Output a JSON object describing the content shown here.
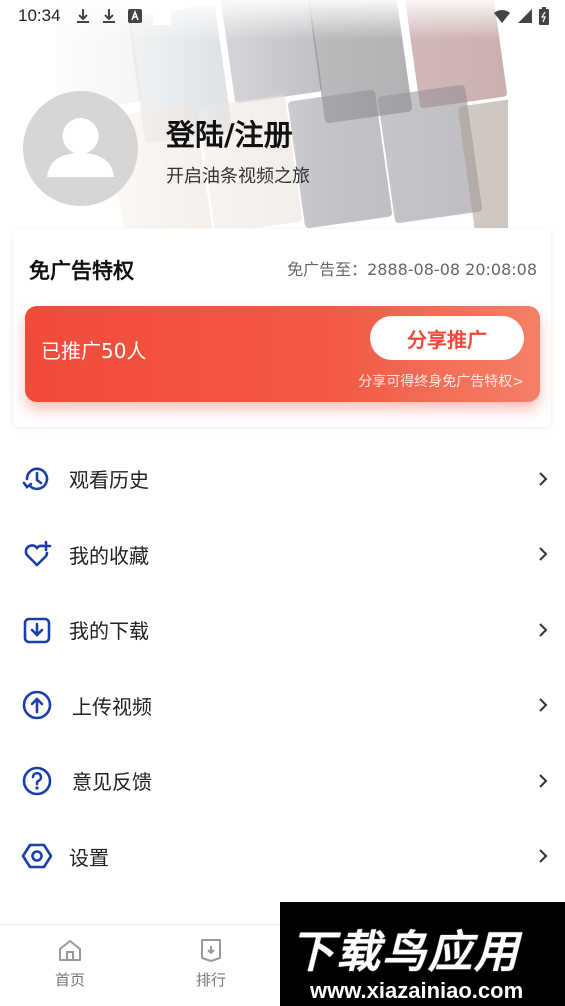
{
  "status_bar": {
    "time": "10:34",
    "left_icons": [
      "download-icon",
      "download-icon",
      "a-icon",
      "blank-square-icon"
    ],
    "right_icons": [
      "wifi-icon",
      "cellular-signal-icon",
      "battery-icon"
    ]
  },
  "profile": {
    "title": "登陆/注册",
    "subtitle": "开启油条视频之旅",
    "avatar_icon": "user-avatar-icon"
  },
  "vip": {
    "title": "免广告特权",
    "expire": "免广告至：2888-08-08 20:08:08",
    "promo_count": "已推广50人",
    "share_button": "分享推广",
    "share_tip": "分享可得终身免广告特权>"
  },
  "menu": [
    {
      "label": "观看历史",
      "icon": "history-icon"
    },
    {
      "label": "我的收藏",
      "icon": "heart-plus-icon"
    },
    {
      "label": "我的下载",
      "icon": "download-box-icon"
    },
    {
      "label": "上传视频",
      "icon": "upload-circle-icon"
    },
    {
      "label": "意见反馈",
      "icon": "question-circle-icon"
    },
    {
      "label": "设置",
      "icon": "settings-hexagon-icon"
    }
  ],
  "bottom_nav": [
    {
      "label": "首页",
      "icon": "home-icon"
    },
    {
      "label": "排行",
      "icon": "ranking-icon"
    }
  ],
  "watermark": {
    "logo_text": "下载鸟应用",
    "url": "www.xiazainiao.com"
  },
  "colors": {
    "accent_blue": "#1a3fa8",
    "promo_red": "#f14b3a",
    "text_dark": "#222222"
  }
}
